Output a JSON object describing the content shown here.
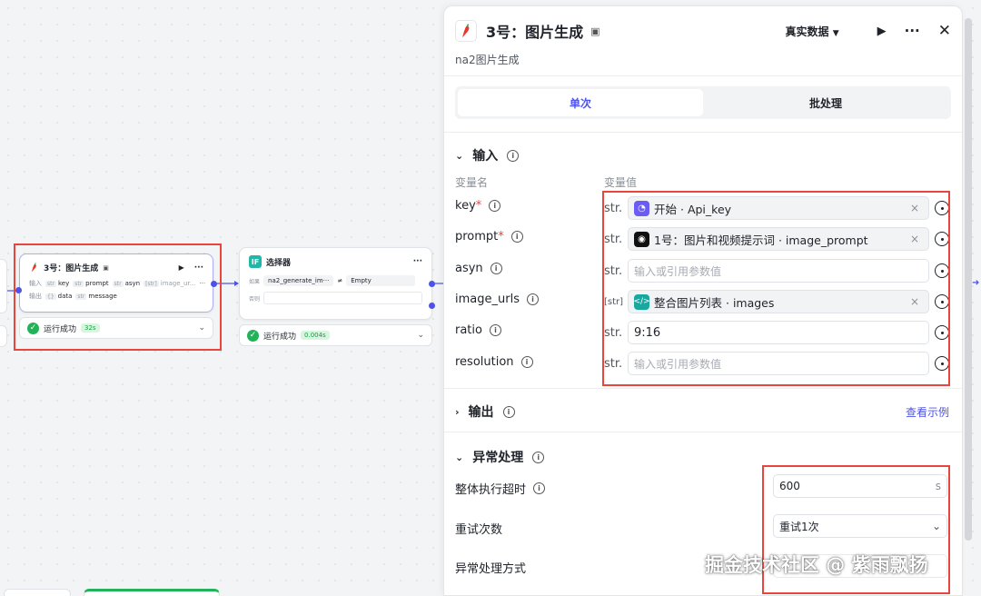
{
  "canvas": {
    "node_image": {
      "title": "3号：图片生成",
      "input_label": "输入",
      "output_label": "输出",
      "inputs": [
        {
          "type": "str",
          "name": "key"
        },
        {
          "type": "str",
          "name": "prompt"
        },
        {
          "type": "str",
          "name": "asyn"
        },
        {
          "type": "[str]",
          "name": "image_ur..."
        }
      ],
      "outputs": [
        {
          "type": "{}",
          "name": "data"
        },
        {
          "type": "str",
          "name": "message"
        }
      ],
      "status": "运行成功",
      "time": "32s"
    },
    "node_selector": {
      "icon": "IF",
      "title": "选择器",
      "if_label": "如果",
      "else_label": "否则",
      "cond_var": "na2_generate_im···",
      "cond_op": "≠",
      "cond_value": "Empty",
      "status": "运行成功",
      "time": "0.004s"
    }
  },
  "panel": {
    "title": "3号：图片生成",
    "subtitle": "na2图片生成",
    "dataset": "真实数据",
    "tabs": [
      "单次",
      "批处理"
    ],
    "input_section": "输入",
    "col_name": "变量名",
    "col_value": "变量值",
    "variables": [
      {
        "name": "key",
        "required": true,
        "type": "str.",
        "ref_source": "开始",
        "ref_var": "Api_key",
        "icon": "start-icon",
        "color": "#6a5cf5"
      },
      {
        "name": "prompt",
        "required": true,
        "type": "str.",
        "ref_source": "1号：图片和视频提示词",
        "ref_var": "image_prompt",
        "icon": "llm-icon",
        "color": "#111111"
      },
      {
        "name": "asyn",
        "required": false,
        "type": "str.",
        "placeholder": "输入或引用参数值"
      },
      {
        "name": "image_urls",
        "required": false,
        "type": "[str]",
        "ref_source": "整合图片列表",
        "ref_var": "images",
        "icon": "code-icon",
        "color": "#18a8a0"
      },
      {
        "name": "ratio",
        "required": false,
        "type": "str.",
        "value": "9:16"
      },
      {
        "name": "resolution",
        "required": false,
        "type": "str.",
        "placeholder": "输入或引用参数值"
      }
    ],
    "output_section": "输出",
    "view_example": "查看示例",
    "exception_section": "异常处理",
    "timeout_label": "整体执行超时",
    "timeout_value": "600",
    "timeout_unit": "s",
    "retry_label": "重试次数",
    "retry_value": "重试1次",
    "handling_label": "异常处理方式"
  },
  "watermark": "掘金技术社区 @ 紫雨飘扬"
}
